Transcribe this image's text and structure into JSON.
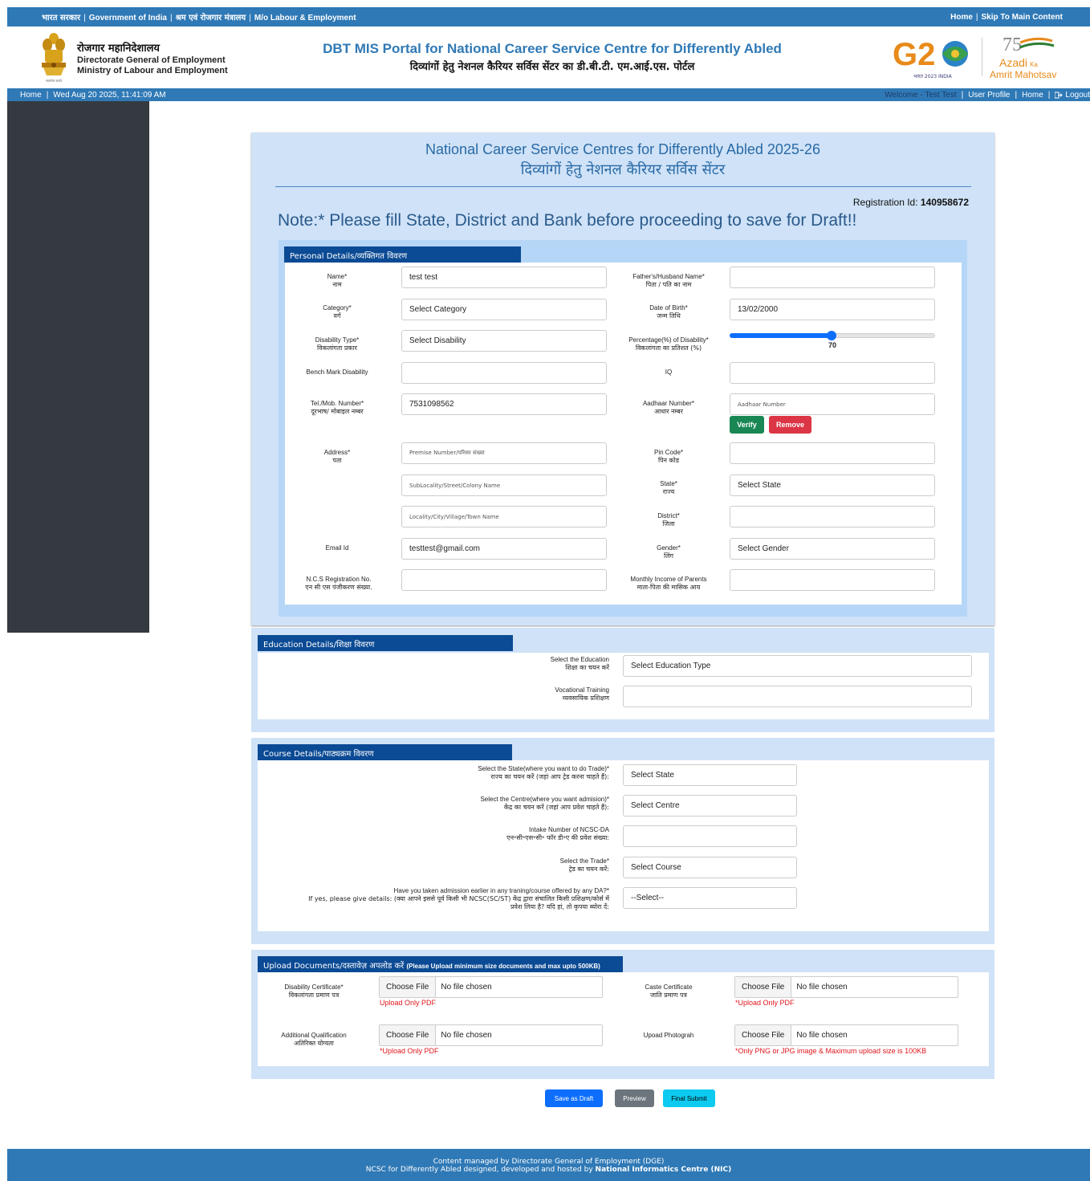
{
  "govbar": {
    "hindi_govt": "भारत सरकार",
    "govt": "Government of India",
    "hindi_ministry": "श्रम एवं रोजगार मंत्रालय",
    "ministry": "M/o Labour & Employment",
    "home": "Home",
    "skip": "Skip To Main Content",
    "color": "#2f79b6"
  },
  "header": {
    "org_hindi": "रोजगार महानिदेशालय",
    "org_line1": "Directorate General of Employment",
    "org_line2": "Ministry of Labour and Employment",
    "emblem_motto": "सत्यमेव जयते",
    "title": "DBT MIS Portal for National Career Service Centre for Differently Abled",
    "title_hindi": "दिव्यांगों हेतु नेशनल कैरियर सर्विस सेंटर का डी.बी.टी. एम.आई.एस. पोर्टल",
    "g20_sub": "भारत 2023 INDIA",
    "azadi_line1": "Azadi",
    "azadi_ka": "Ka",
    "azadi_line2": "Amrit Mahotsav"
  },
  "navbar": {
    "home": "Home",
    "datetime": "Wed Aug 20 2025, 11:41:09 AM",
    "welcome": "Welcome - Test Test",
    "user_profile": "User Profile",
    "home2": "Home",
    "logout": "Logout"
  },
  "form": {
    "title": "National Career Service Centres for Differently Abled 2025-26",
    "title_hindi": "दिव्यांगों हेतु नेशनल कैरियर सर्विस सेंटर",
    "reg_label": "Registration Id:",
    "reg_id": "140958672",
    "note": "Note:* Please fill State, District and Bank before proceeding to save for Draft!!"
  },
  "personal": {
    "section": "Personal Details/व्यक्तिगत विवरण",
    "name_label": "Name*",
    "name_hi": "नाम",
    "name_value": "test test",
    "father_label": "Father's/Husband Name*",
    "father_hi": "पिता / पति का नाम",
    "father_value": "",
    "category_label": "Category*",
    "category_hi": "वर्ग",
    "category_value": "Select Category",
    "dob_label": "Date of Birth*",
    "dob_hi": "जन्म तिथि",
    "dob_value": "13/02/2000",
    "disability_label": "Disability Type*",
    "disability_hi": "विकलांगता प्रकार",
    "disability_value": "Select Disability",
    "percent_label": "Percentage(%) of Disability*",
    "percent_hi": "विकलांगता का प्रतिशत (%)",
    "percent_value": "70",
    "bench_label": "Bench Mark Disability",
    "bench_value": "",
    "iq_label": "IQ",
    "iq_value": "",
    "tel_label": "Tel./Mob. Number*",
    "tel_hi": "दूरभाष/ मोबाइल नम्बर",
    "tel_value": "7531098562",
    "aadhaar_label": "Aadhaar Number*",
    "aadhaar_hi": "आधार नम्बर",
    "aadhaar_placeholder": "Aadhaar Number",
    "verify": "Verify",
    "remove": "Remove",
    "address_label": "Address*",
    "address_hi": "पता",
    "addr1_placeholder": "Premise Number/परिसर संख्या",
    "addr2_placeholder": "SubLocality/Street/Colony Name",
    "addr3_placeholder": "Locality/City/Village/Town Name",
    "pin_label": "Pin Code*",
    "pin_hi": "पिन कोड",
    "pin_value": "",
    "state_label": "State*",
    "state_hi": "राज्य",
    "state_value": "Select State",
    "district_label": "District*",
    "district_hi": "जिला",
    "district_value": "",
    "email_label": "Email Id",
    "email_value": "testtest@gmail.com",
    "gender_label": "Gender*",
    "gender_hi": "लिंग",
    "gender_value": "Select Gender",
    "ncs_label": "N.C.S Registration No.",
    "ncs_hi": "एन सी एस पंजीकरण संख्या.",
    "ncs_value": "",
    "income_label": "Monthly Income of Parents",
    "income_hi": "माता-पिता की मासिक आय",
    "income_value": ""
  },
  "education": {
    "section": "Education Details/शिक्षा विवरण",
    "edu_label": "Select the Education",
    "edu_hi": "शिक्षा का चयन करें",
    "edu_value": "Select Education Type",
    "voc_label": "Vocational Training",
    "voc_hi": "व्यवसायिक प्रशिक्षण",
    "voc_value": ""
  },
  "course": {
    "section": "Course Details/पाठ्यक्रम विवरण",
    "state_label": "Select the State(where you want to do Trade)*",
    "state_hi": "राज्य का चयन करें (जहां आप ट्रेड करना चाहते हैं):",
    "state_value": "Select State",
    "centre_label": "Select the Centre(where you want admision)*",
    "centre_hi": "केंद्र का चयन करें (जहां आप प्रवेश चाहते हैं):",
    "centre_value": "Select Centre",
    "intake_label": "Intake Number of NCSC-DA",
    "intake_hi": "एन॰सी॰एस॰सी॰ फॉर डी॰ए की प्रवेश संख्या:",
    "intake_value": "",
    "trade_label": "Select the Trade*",
    "trade_hi": "ट्रेड का चयन करें:",
    "trade_value": "Select Course",
    "prior_label": "Have you taken admission earlier in any traning/course offered by any DA?*",
    "prior_hi1": "If yes, please give details: (क्या आपने इससे पूर्व किसी भी NCSC(SC/ST) केंद्र द्वारा संचालित किसी प्रशिक्षण/कोर्स में",
    "prior_hi2": "प्रवेश लिया है? यदि हां, तो कृपया ब्योरा दें:",
    "prior_value": "--Select--"
  },
  "upload": {
    "section": "Upload Documents/दस्तावेज़ अपलोड करें",
    "section_note": "(Please Upload minimum size documents and max upto 500KB)",
    "choose": "Choose File",
    "none": "No file chosen",
    "disability_label": "Disability Certificate*",
    "disability_hi": "विकलांगता प्रमाण पत्र",
    "disability_note": "Upload Only PDF",
    "caste_label": "Caste Certificate",
    "caste_hi": "जाति प्रमाण पत्र",
    "caste_note": "*Upload Only PDF",
    "addl_label": "Additional Qualification",
    "addl_hi": "अतिरिक्त योग्यता",
    "addl_note": "*Upload Only PDF",
    "photo_label": "Upoad Photograh",
    "photo_note": "*Only PNG or JPG image & Maximum upload size is 100KB"
  },
  "actions": {
    "draft": "Save as Draft",
    "preview": "Preview",
    "submit": "Final Submit"
  },
  "footer": {
    "line1": "Content managed by Directorate General of Employment (DGE)",
    "line2a": "NCSC for Differently Abled designed, developed and hosted by",
    "line2b": "National Informatics Centre (NIC)"
  }
}
